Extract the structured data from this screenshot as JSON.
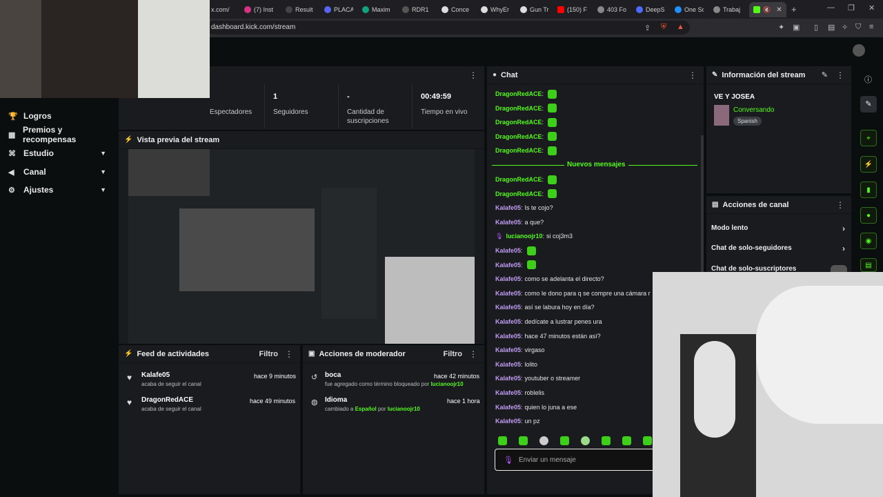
{
  "browser": {
    "tabs": [
      "x.com/",
      "(7) Inst",
      "Resulta",
      "PLACA",
      "Maxim",
      "RDR1",
      "Conce",
      "WhyEr",
      "Gun Tr",
      "(150) F",
      "403 Fo",
      "DeepS",
      "One Sc",
      "Trabaj",
      ""
    ],
    "url": "dashboard.kick.com/stream"
  },
  "sidebar": {
    "items": [
      {
        "label": "Logros",
        "icon": "trophy-icon",
        "chevron": false
      },
      {
        "label": "Premios y recompensas",
        "icon": "gift-icon",
        "chevron": false
      },
      {
        "label": "Estudio",
        "icon": "studio-icon",
        "chevron": true
      },
      {
        "label": "Canal",
        "icon": "megaphone-icon",
        "chevron": true
      },
      {
        "label": "Ajustes",
        "icon": "gear-icon",
        "chevron": true
      }
    ]
  },
  "stats": [
    {
      "value": "",
      "label": "Espectadores"
    },
    {
      "value": "1",
      "label": "Seguidores"
    },
    {
      "value": "-",
      "label": "Cantidad de suscripciones"
    },
    {
      "value": "00:49:59",
      "label": "Tiempo en vivo"
    }
  ],
  "preview": {
    "title": "Vista previa del stream"
  },
  "feed": {
    "title": "Feed de actividades",
    "filter": "Filtro",
    "items": [
      {
        "user": "Kalafe05",
        "text": "acaba de seguir el canal",
        "time": "hace 9 minutos"
      },
      {
        "user": "DragonRedACE",
        "text": "acaba de seguir el canal",
        "time": "hace 49 minutos"
      }
    ]
  },
  "mod": {
    "title": "Acciones de moderador",
    "filter": "Filtro",
    "items": [
      {
        "title": "boca",
        "text": "fue agregado como término bloqueado por",
        "by": "lucianoojr10",
        "time": "hace 42 minutos"
      },
      {
        "title": "Idioma",
        "text_pre": "cambiado a",
        "lang": "Español",
        "text_mid": "por",
        "by": "lucianoojr10",
        "time": "hace 1 hora"
      }
    ]
  },
  "chat": {
    "title": "Chat",
    "new_messages": "Nuevos mensajes",
    "input_placeholder": "Enviar un mensaje",
    "messages_top": [
      {
        "user": "DragonRedACE",
        "color": "green",
        "text": "",
        "emote": true
      },
      {
        "user": "DragonRedACE",
        "color": "green",
        "text": "",
        "emote": true
      },
      {
        "user": "DragonRedACE",
        "color": "green",
        "text": "",
        "emote": true
      },
      {
        "user": "DragonRedACE",
        "color": "green",
        "text": "",
        "emote": true
      },
      {
        "user": "DragonRedACE",
        "color": "green",
        "text": "",
        "emote": true
      }
    ],
    "messages_new": [
      {
        "user": "DragonRedACE",
        "color": "green",
        "text": "",
        "emote": true
      },
      {
        "user": "DragonRedACE",
        "color": "green",
        "text": "",
        "emote": true
      },
      {
        "user": "Kalafe05",
        "color": "purple",
        "text": "Is te cojo?"
      },
      {
        "user": "Kalafe05",
        "color": "purple",
        "text": "a que?"
      },
      {
        "user": "lucianoojr10",
        "color": "green",
        "text": "si coj3m3",
        "mic": true
      },
      {
        "user": "Kalafe05",
        "color": "purple",
        "text": "",
        "emote": true
      },
      {
        "user": "Kalafe05",
        "color": "purple",
        "text": "",
        "emote": true
      },
      {
        "user": "Kalafe05",
        "color": "purple",
        "text": "como se adelanta el directo?"
      },
      {
        "user": "Kalafe05",
        "color": "purple",
        "text": "como le dono para q se compre una cámara r"
      },
      {
        "user": "Kalafe05",
        "color": "purple",
        "text": "así se labura hoy en día?"
      },
      {
        "user": "Kalafe05",
        "color": "purple",
        "text": "dedícate a lustrar penes ura"
      },
      {
        "user": "Kalafe05",
        "color": "purple",
        "text": "hace 47 minutos están así?"
      },
      {
        "user": "Kalafe05",
        "color": "purple",
        "text": "virgaso"
      },
      {
        "user": "Kalafe05",
        "color": "purple",
        "text": "lolito"
      },
      {
        "user": "Kalafe05",
        "color": "purple",
        "text": "youtuber o streamer"
      },
      {
        "user": "Kalafe05",
        "color": "purple",
        "text": "roblelis"
      },
      {
        "user": "Kalafe05",
        "color": "purple",
        "text": "quien lo juna a ese"
      },
      {
        "user": "Kalafe05",
        "color": "purple",
        "text": "un pz"
      }
    ]
  },
  "stream_info": {
    "title": "Información del stream",
    "stream_title": "VE Y JOSEA",
    "category": "Conversando",
    "language": "Spanish"
  },
  "channel_actions": {
    "title": "Acciones de canal",
    "items": [
      "Modo lento",
      "Chat de solo-seguidores",
      "Chat de solo-suscriptores"
    ]
  },
  "colors": {
    "accent": "#53fc18",
    "purple": "#c39cf4",
    "panel": "#191b1f",
    "bg": "#0b0e0f"
  }
}
